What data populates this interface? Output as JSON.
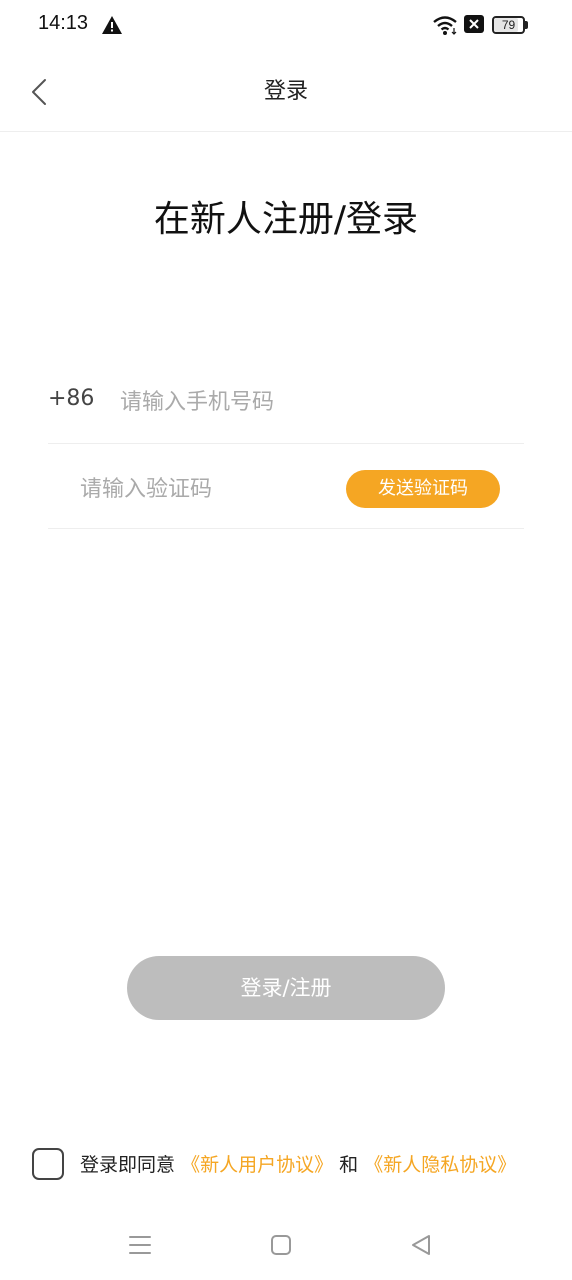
{
  "status_bar": {
    "time": "14:13",
    "battery_level": "79",
    "icons": [
      "warning-icon",
      "wifi-icon",
      "sim-no-service-icon",
      "battery-icon"
    ]
  },
  "header": {
    "title": "登录",
    "back_icon": "chevron-left-icon"
  },
  "main": {
    "title": "在新人注册/登录"
  },
  "form": {
    "country_code": "+86",
    "phone_placeholder": "请输入手机号码",
    "phone_value": "",
    "code_placeholder": "请输入验证码",
    "code_value": "",
    "send_code_label": "发送验证码"
  },
  "login_button": {
    "label": "登录/注册"
  },
  "agreement": {
    "prefix": "登录即同意",
    "user_agreement": "《新人用户协议》",
    "joiner": "和",
    "privacy_policy": "《新人隐私协议》"
  },
  "nav_bar": {
    "icons": [
      "menu-icon",
      "home-icon",
      "back-triangle-icon"
    ]
  },
  "colors": {
    "accent": "#f5a623",
    "button_disabled": "#bdbdbd",
    "divider": "#eeeeee",
    "placeholder": "#aaaaaa"
  }
}
